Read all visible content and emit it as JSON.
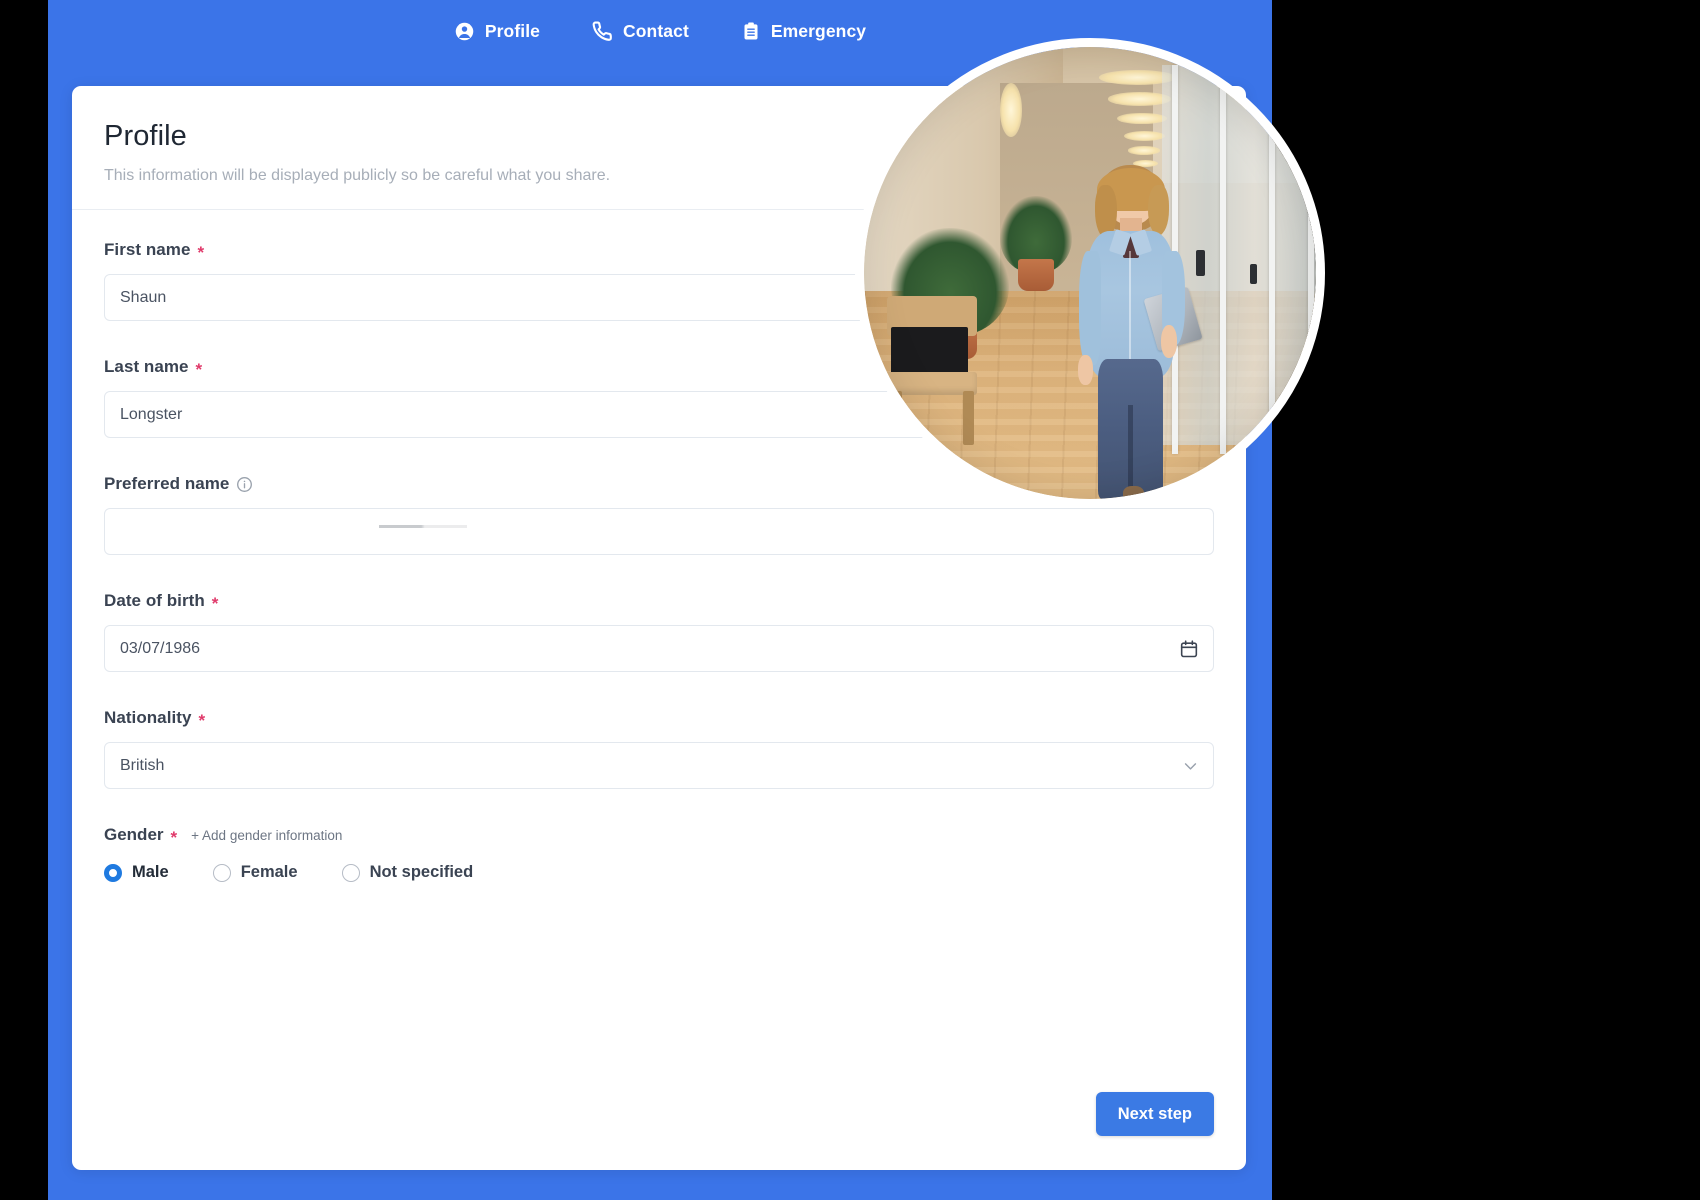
{
  "nav": {
    "items": [
      {
        "label": "Profile",
        "icon": "user-circle-icon",
        "active": true
      },
      {
        "label": "Contact",
        "icon": "phone-icon",
        "active": false
      },
      {
        "label": "Emergency",
        "icon": "clipboard-icon",
        "active": false
      }
    ]
  },
  "card": {
    "title": "Profile",
    "subtitle": "This information will be displayed publicly so be careful what you share."
  },
  "fields": {
    "first_name": {
      "label": "First name",
      "required_mark": "*",
      "value": "Shaun",
      "placeholder": ""
    },
    "last_name": {
      "label": "Last name",
      "required_mark": "*",
      "value": "Longster",
      "placeholder": ""
    },
    "preferred_name": {
      "label": "Preferred name",
      "required_mark": "",
      "value": "",
      "placeholder": "",
      "info_icon": "info-circle-icon"
    },
    "date_of_birth": {
      "label": "Date of birth",
      "required_mark": "*",
      "value": "03/07/1986",
      "placeholder": "",
      "icon": "calendar-icon"
    },
    "nationality": {
      "label": "Nationality",
      "required_mark": "*",
      "value": "British",
      "icon": "chevron-down-icon"
    },
    "gender": {
      "label": "Gender",
      "required_mark": "*",
      "add_link": "+ Add gender information",
      "options": [
        {
          "label": "Male",
          "selected": true
        },
        {
          "label": "Female",
          "selected": false
        },
        {
          "label": "Not specified",
          "selected": false
        }
      ]
    }
  },
  "footer": {
    "next_label": "Next step"
  },
  "media": {
    "photo_alt": "Woman walking in office corridor holding tablet"
  },
  "colors": {
    "brand_blue": "#3b74e8",
    "button_blue": "#3b7ae4",
    "radio_blue": "#1f7ae0",
    "required_red": "#e0396a",
    "label_text": "#3a4352",
    "muted_text": "#a7aeb8",
    "input_border": "#e3e8ee",
    "page_black": "#000000"
  }
}
